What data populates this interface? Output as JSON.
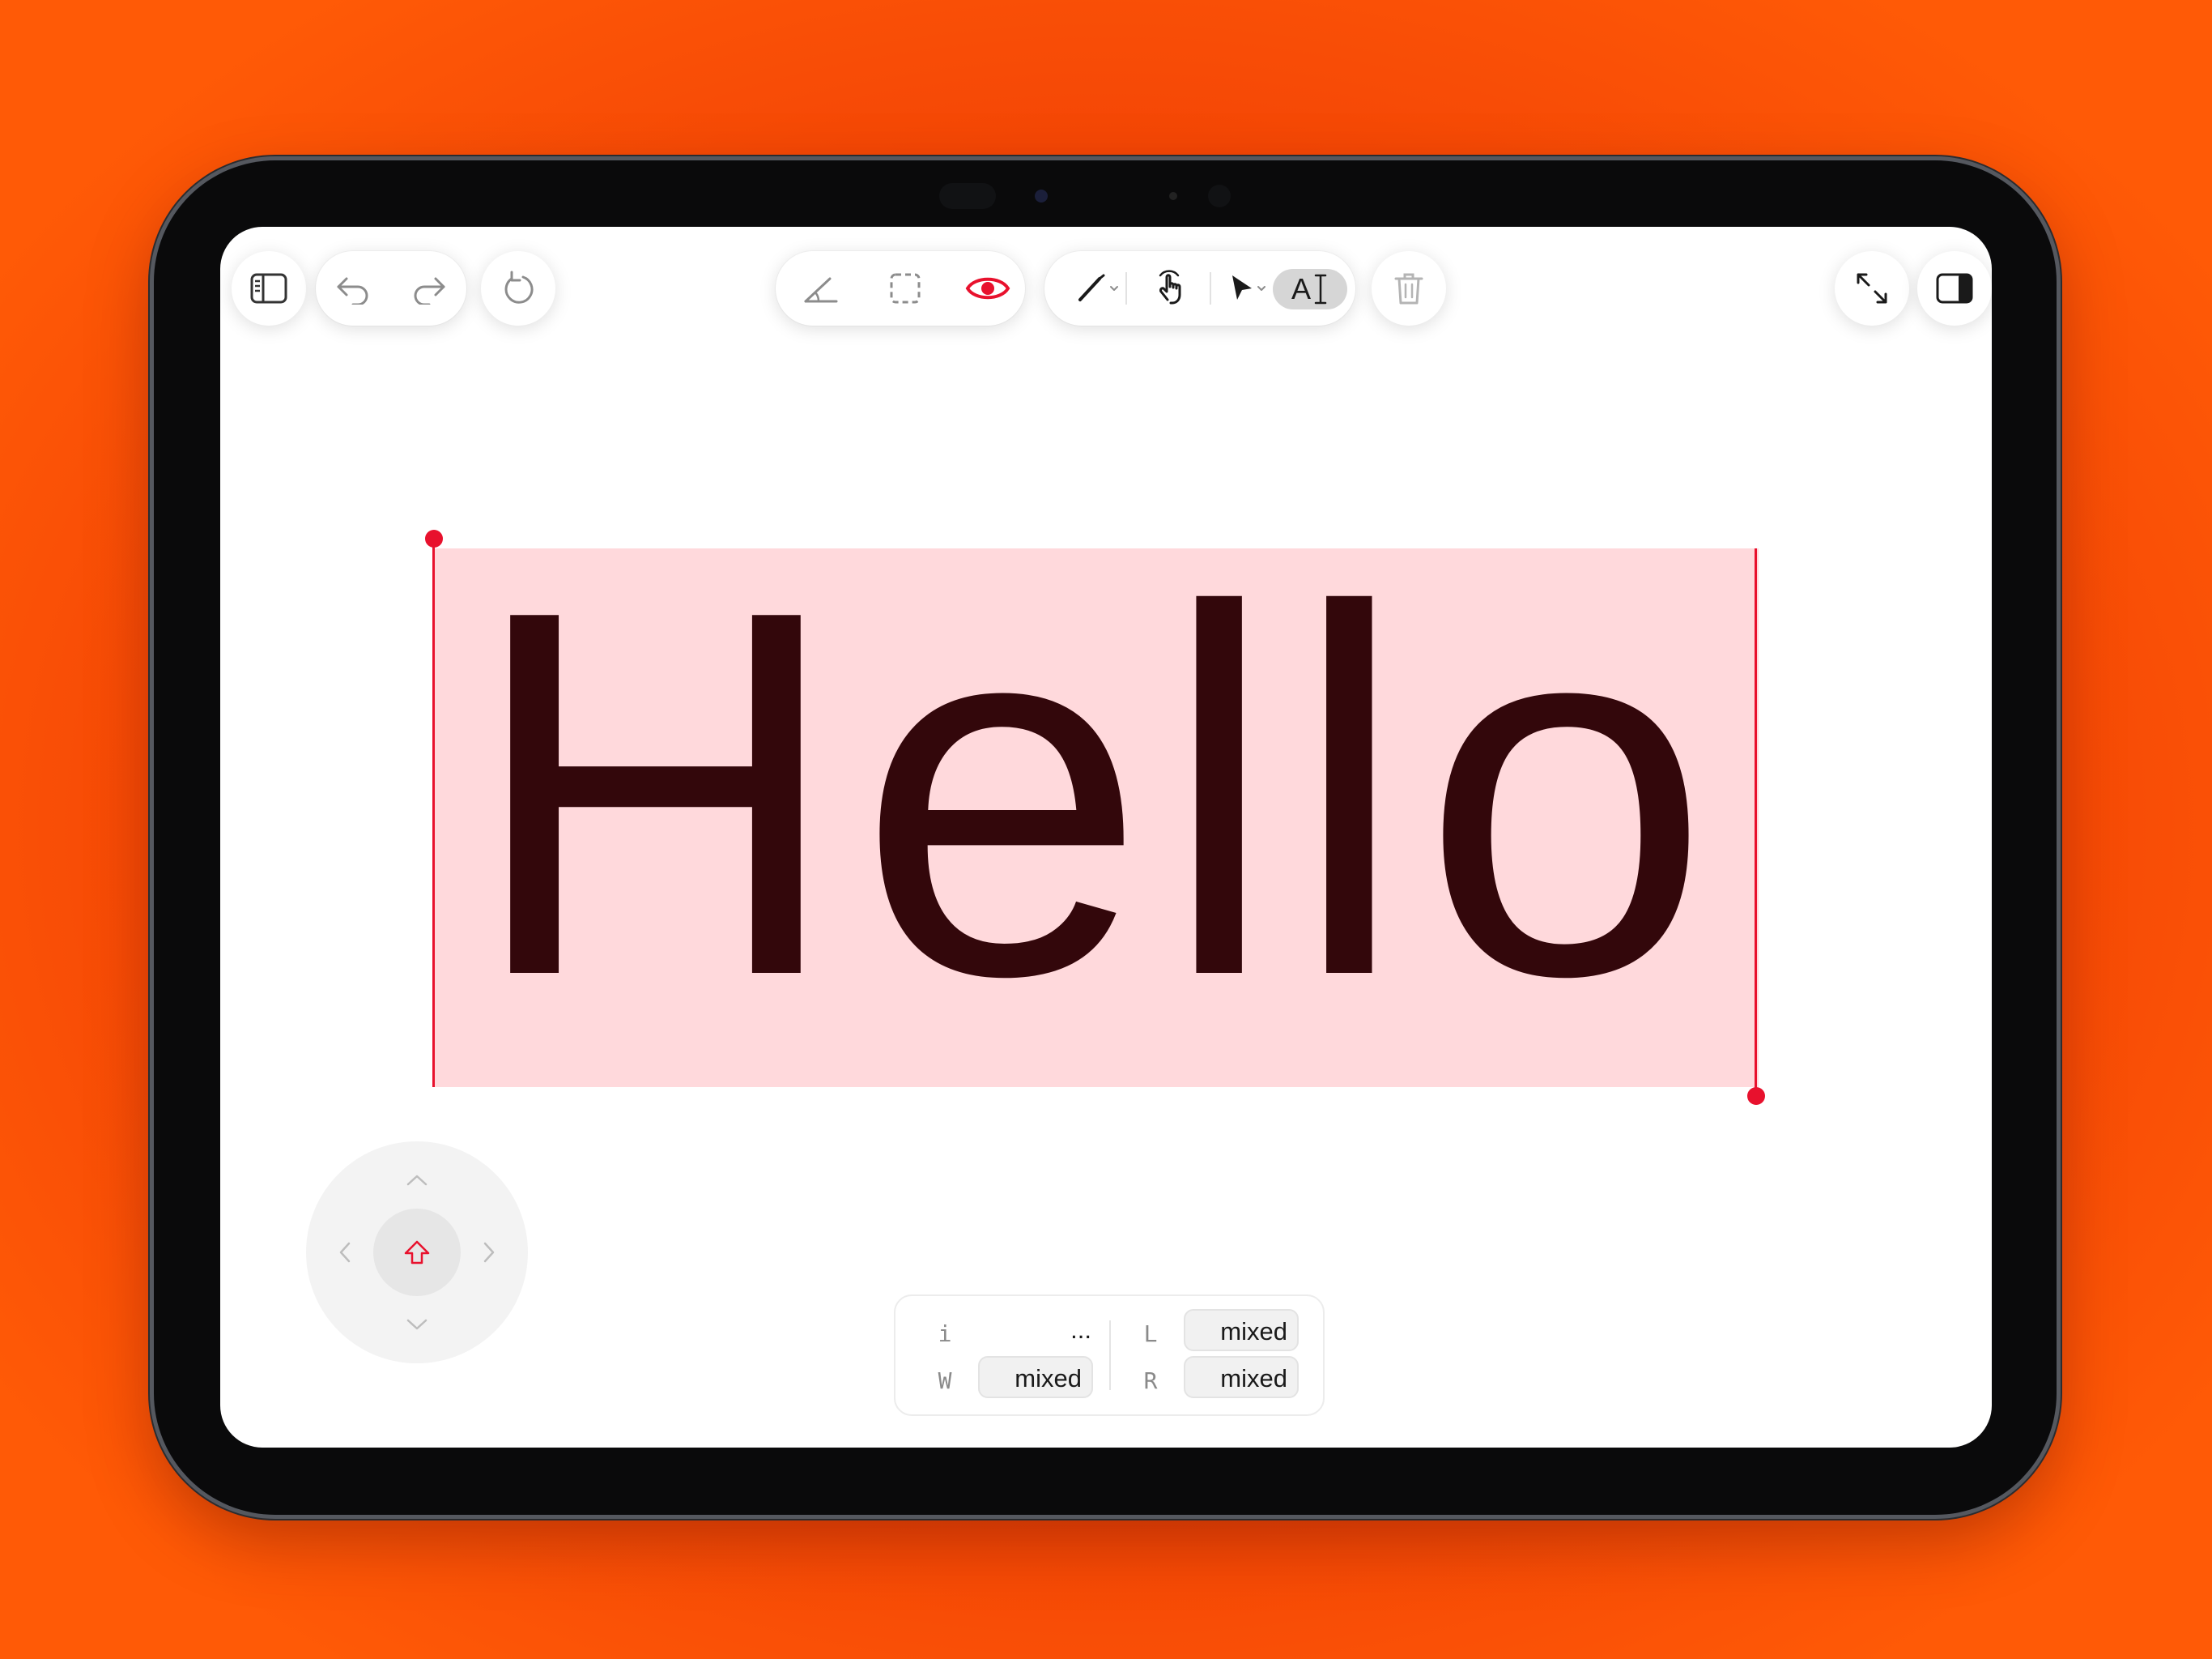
{
  "colors": {
    "background": "#ff5a06",
    "accent": "#e8112d",
    "selection_fill": "#ffd9dc",
    "text_color": "#33070b"
  },
  "toolbar": {
    "left": [
      {
        "name": "sidebar-toggle-button",
        "icon": "sidebar-left-icon"
      },
      {
        "name": "undo-button",
        "icon": "undo-icon"
      },
      {
        "name": "redo-button",
        "icon": "redo-icon"
      },
      {
        "name": "reset-button",
        "icon": "rotate-ccw-icon"
      }
    ],
    "center": [
      {
        "name": "angle-tool-button",
        "icon": "angle-icon"
      },
      {
        "name": "marquee-select-button",
        "icon": "dashed-rect-icon"
      },
      {
        "name": "visibility-button",
        "icon": "eye-icon",
        "active": true
      },
      {
        "name": "pen-tool-button",
        "icon": "pen-icon"
      },
      {
        "name": "hand-tool-button",
        "icon": "hand-pointer-icon"
      },
      {
        "name": "pointer-tool-button",
        "icon": "arrow-cursor-icon"
      },
      {
        "name": "text-tool-button",
        "icon": "text-cursor-icon",
        "label": "A",
        "selected": true
      },
      {
        "name": "delete-button",
        "icon": "trash-icon"
      }
    ],
    "right": [
      {
        "name": "fullscreen-button",
        "icon": "expand-icon"
      },
      {
        "name": "inspector-toggle-button",
        "icon": "sidebar-right-icon"
      }
    ]
  },
  "canvas": {
    "text": "Hello"
  },
  "properties": {
    "info_label": "i",
    "info_value": "...",
    "width_label": "W",
    "width_value": "mixed",
    "left_label": "L",
    "left_value": "mixed",
    "right_label": "R",
    "right_value": "mixed"
  },
  "dpad": {
    "center_icon": "shift-arrow-icon",
    "arrows": [
      "chevron-up-icon",
      "chevron-left-icon",
      "chevron-right-icon",
      "chevron-down-icon"
    ]
  }
}
